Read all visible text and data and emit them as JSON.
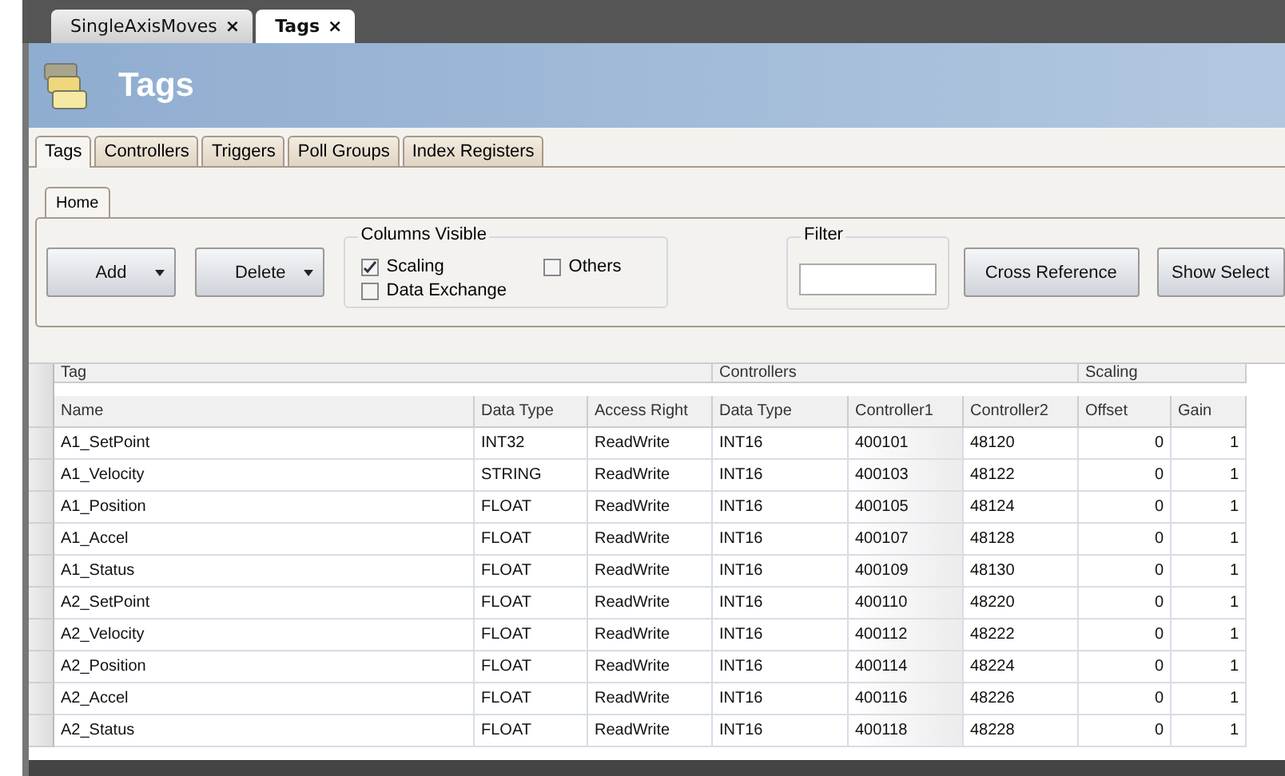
{
  "doc_tabs": [
    {
      "label": "SingleAxisMoves",
      "close": "×",
      "selected": false
    },
    {
      "label": "Tags",
      "close": "×",
      "selected": true
    }
  ],
  "header": {
    "title": "Tags"
  },
  "tabs": [
    {
      "label": "Tags",
      "selected": true
    },
    {
      "label": "Controllers",
      "selected": false
    },
    {
      "label": "Triggers",
      "selected": false
    },
    {
      "label": "Poll Groups",
      "selected": false
    },
    {
      "label": "Index Registers",
      "selected": false
    }
  ],
  "ribbon": {
    "tab": "Home",
    "add": "Add",
    "delete": "Delete",
    "columns_visible": {
      "title": "Columns Visible",
      "options": [
        {
          "label": "Scaling",
          "checked": true
        },
        {
          "label": "Others",
          "checked": false
        },
        {
          "label": "Data Exchange",
          "checked": false
        }
      ]
    },
    "filter": {
      "title": "Filter"
    },
    "buttons": [
      "Cross Reference",
      "Show Select"
    ]
  },
  "table": {
    "groups": [
      "Tag",
      "Controllers",
      "Scaling"
    ],
    "columns": [
      "Name",
      "Data Type",
      "Access Right",
      "Data Type",
      "Controller1",
      "Controller2",
      "Offset",
      "Gain"
    ],
    "rows": [
      [
        "A1_SetPoint",
        "INT32",
        "ReadWrite",
        "INT16",
        "400101",
        "48120",
        "0",
        "1"
      ],
      [
        "A1_Velocity",
        "STRING",
        "ReadWrite",
        "INT16",
        "400103",
        "48122",
        "0",
        "1"
      ],
      [
        "A1_Position",
        "FLOAT",
        "ReadWrite",
        "INT16",
        "400105",
        "48124",
        "0",
        "1"
      ],
      [
        "A1_Accel",
        "FLOAT",
        "ReadWrite",
        "INT16",
        "400107",
        "48128",
        "0",
        "1"
      ],
      [
        "A1_Status",
        "FLOAT",
        "ReadWrite",
        "INT16",
        "400109",
        "48130",
        "0",
        "1"
      ],
      [
        "A2_SetPoint",
        "FLOAT",
        "ReadWrite",
        "INT16",
        "400110",
        "48220",
        "0",
        "1"
      ],
      [
        "A2_Velocity",
        "FLOAT",
        "ReadWrite",
        "INT16",
        "400112",
        "48222",
        "0",
        "1"
      ],
      [
        "A2_Position",
        "FLOAT",
        "ReadWrite",
        "INT16",
        "400114",
        "48224",
        "0",
        "1"
      ],
      [
        "A2_Accel",
        "FLOAT",
        "ReadWrite",
        "INT16",
        "400116",
        "48226",
        "0",
        "1"
      ],
      [
        "A2_Status",
        "FLOAT",
        "ReadWrite",
        "INT16",
        "400118",
        "48228",
        "0",
        "1"
      ]
    ]
  }
}
